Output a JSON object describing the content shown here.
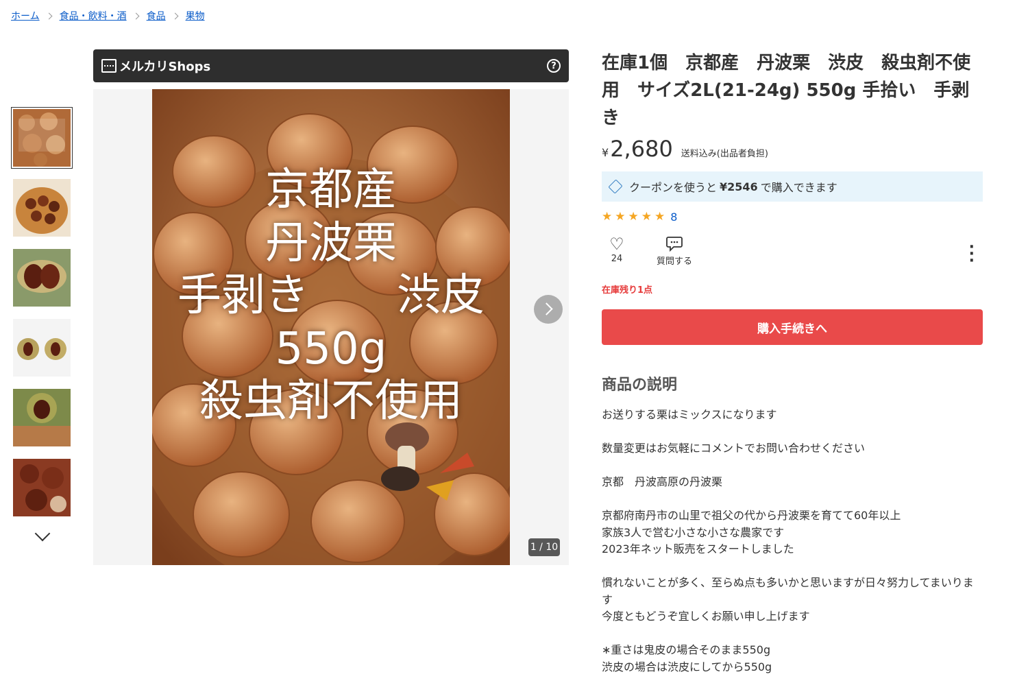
{
  "breadcrumb": [
    "ホーム",
    "食品・飲料・酒",
    "食品",
    "果物"
  ],
  "shop": {
    "name": "メルカリShops",
    "help": "?"
  },
  "gallery": {
    "overlay_lines": [
      "京都産",
      "丹波栗",
      "手剥き　　渋皮",
      "550g",
      "殺虫剤不使用"
    ],
    "counter": "1 / 10",
    "thumb_count": 6
  },
  "product": {
    "title": "在庫1個　京都産　丹波栗　渋皮　殺虫剤不使用　サイズ2L(21-24g) 550g 手拾い　手剥き",
    "currency": "¥",
    "price": "2,680",
    "shipping": "送料込み(出品者負担)",
    "coupon_prefix": "クーポンを使うと",
    "coupon_amount": "¥2546",
    "coupon_suffix": "で購入できます",
    "rating_stars": 5,
    "rating_count": "8",
    "likes": "24",
    "question_label": "質問する",
    "stock_note": "在庫残り1点",
    "buy_label": "購入手続きへ"
  },
  "description": {
    "heading": "商品の説明",
    "paragraphs": [
      "お送りする栗はミックスになります",
      "数量変更はお気軽にコメントでお問い合わせください",
      "京都　丹波高原の丹波栗",
      "京都府南丹市の山里で祖父の代から丹波栗を育てて60年以上\n家族3人で営む小さな小さな農家です\n2023年ネット販売をスタートしました",
      "慣れないことが多く、至らぬ点も多いかと思いますが日々努力してまいります\n今度ともどうぞ宜しくお願い申し上げます",
      "∗重さは鬼皮の場合そのまま550g\n渋皮の場合は渋皮にしてから550g"
    ]
  },
  "colors": {
    "accent": "#e94a4a",
    "link": "#0b5cc9",
    "coupon_bg": "#e7f4fb",
    "star": "#f5a623"
  }
}
